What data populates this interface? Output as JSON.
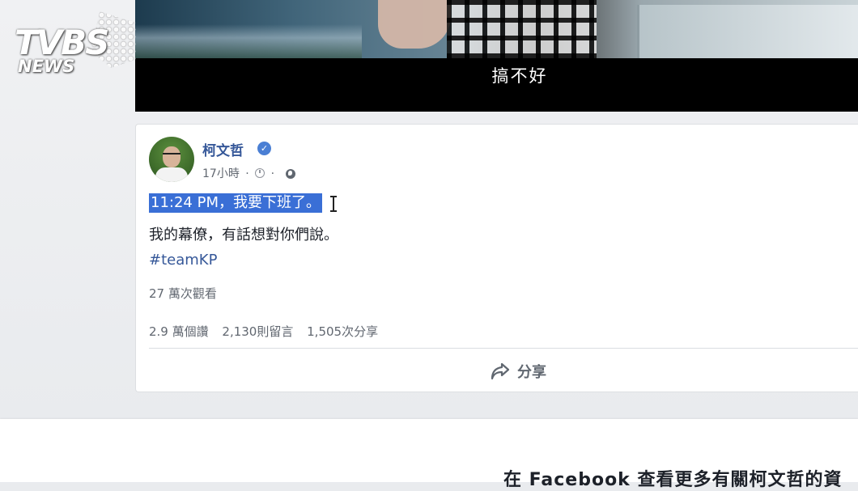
{
  "channel_logo": {
    "brand": "TVBS",
    "sub": "NEWS"
  },
  "video": {
    "subtitle": "搞不好"
  },
  "post": {
    "author": "柯文哲",
    "time": "17小時",
    "dot_separator": "·",
    "selected_text": "11:24 PM，我要下班了。",
    "body_line": "我的幕僚，有話想對你們說。",
    "hashtag": "#teamKP",
    "views": "27 萬次觀看",
    "stats": {
      "likes": "2.9 萬個讚",
      "comments": "2,130則留言",
      "shares": "1,505次分享"
    },
    "share_label": "分享"
  },
  "footer": {
    "text": "在 Facebook 查看更多有關柯文哲的資"
  },
  "colors": {
    "facebook_link": "#365899",
    "selection": "#3a6fd6",
    "verified": "#4a7fd4",
    "background": "#e9ebee"
  },
  "icons": [
    "verified-badge-icon",
    "clock-icon",
    "globe-icon",
    "share-arrow-icon",
    "text-cursor-icon"
  ]
}
